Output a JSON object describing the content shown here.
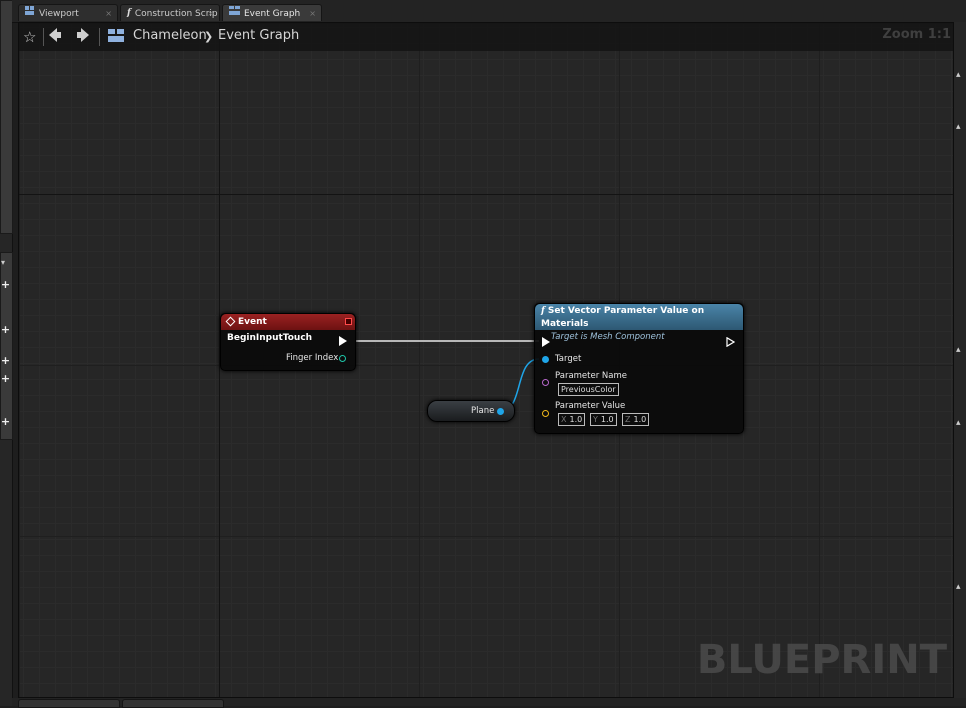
{
  "tabs": [
    {
      "label": "Viewport",
      "icon": "viewport-icon"
    },
    {
      "label": "Construction Scrip",
      "icon": "function-icon"
    },
    {
      "label": "Event Graph",
      "icon": "event-graph-icon",
      "active": true
    }
  ],
  "nav": {
    "breadcrumb_root": "Chameleon",
    "breadcrumb_sep": "❯",
    "breadcrumb_current": "Event Graph",
    "zoom": "Zoom 1:1"
  },
  "watermark": "BLUEPRINT",
  "nodes": {
    "event": {
      "title": "Event BeginInputTouch",
      "pin_finger_index": "Finger Index"
    },
    "set_vector": {
      "title": "Set Vector Parameter Value on Materials",
      "subtitle": "Target is Mesh Component",
      "pin_target": "Target",
      "pin_param_name": "Parameter Name",
      "param_name_value": "PreviousColor",
      "pin_param_value": "Parameter Value",
      "x_label": "X",
      "x_value": "1.0",
      "y_label": "Y",
      "y_value": "1.0",
      "z_label": "Z",
      "z_value": "1.0"
    },
    "plane": {
      "label": "Plane"
    }
  },
  "colors": {
    "event_header": "#8b1a1a",
    "function_header": "#3d6f8e",
    "object_pin": "#1fa5e8",
    "name_pin": "#b667c9",
    "vector_pin": "#f0b81a",
    "int_pin": "#1ec6a8"
  }
}
